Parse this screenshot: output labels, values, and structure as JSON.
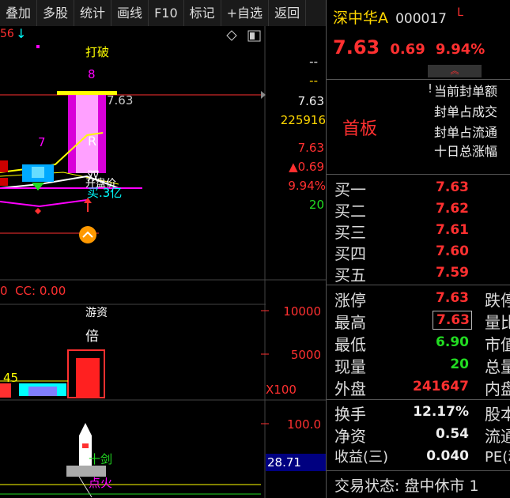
{
  "toolbar": {
    "items": [
      "叠加",
      "多股",
      "统计",
      "画线",
      "F10",
      "标记",
      "+自选",
      "返回"
    ]
  },
  "chart": {
    "top_left_value": "56",
    "annotation_top": "打破",
    "num_8": "8",
    "price_line": "7.63",
    "num_7": "7",
    "r_label": "R",
    "double_label": "双",
    "open_label": "开盘价",
    "buy_label": "买.3亿",
    "right_axis": {
      "dash1": "--",
      "dash2": "--",
      "price": "7.63",
      "volume": "225916",
      "price2": "7.63",
      "change": "▲0.69",
      "pct": "9.94%",
      "count": "20"
    },
    "cc_label": "0  CC: 0.00",
    "vol_header": "游资",
    "bei": "倍",
    "axis_10000": "10000",
    "axis_5000": "5000",
    "x100": "X100",
    "num_45": "45",
    "axis_100": "100.0",
    "sword_label": "十剑",
    "fire_label": "点火",
    "bottom_value": "28.71"
  },
  "quote": {
    "name": "深中华A",
    "code": "000017",
    "flag": "L",
    "price": "7.63",
    "change": "0.69",
    "pct": "9.94%",
    "section_label": "首板",
    "seal_amount": "当前封单额",
    "seal_deal": "封单占成交",
    "seal_float": "封单占流通",
    "ten_day": "十日总涨幅",
    "bids": [
      {
        "label": "买一",
        "price": "7.63"
      },
      {
        "label": "买二",
        "price": "7.62"
      },
      {
        "label": "买三",
        "price": "7.61"
      },
      {
        "label": "买四",
        "price": "7.60"
      },
      {
        "label": "买五",
        "price": "7.59"
      }
    ],
    "stats": [
      {
        "label": "涨停",
        "value": "7.63",
        "color": "#ff3030",
        "right": "跌停"
      },
      {
        "label": "最高",
        "value": "7.63",
        "color": "#ff3030",
        "right": "量比"
      },
      {
        "label": "最低",
        "value": "6.90",
        "color": "#22dd22",
        "right": "市值"
      },
      {
        "label": "现量",
        "value": "20",
        "color": "#22dd22",
        "right": "总量"
      },
      {
        "label": "外盘",
        "value": "241647",
        "color": "#ff3030",
        "right": "内盘"
      }
    ],
    "stats2": [
      {
        "label": "换手",
        "value": "12.17%",
        "right": "股本"
      },
      {
        "label": "净资",
        "value": "0.54",
        "right": "流通"
      },
      {
        "label": "收益(三)",
        "value": "0.040",
        "right": "PE(动"
      }
    ],
    "status": "交易状态: 盘中休市 1"
  }
}
